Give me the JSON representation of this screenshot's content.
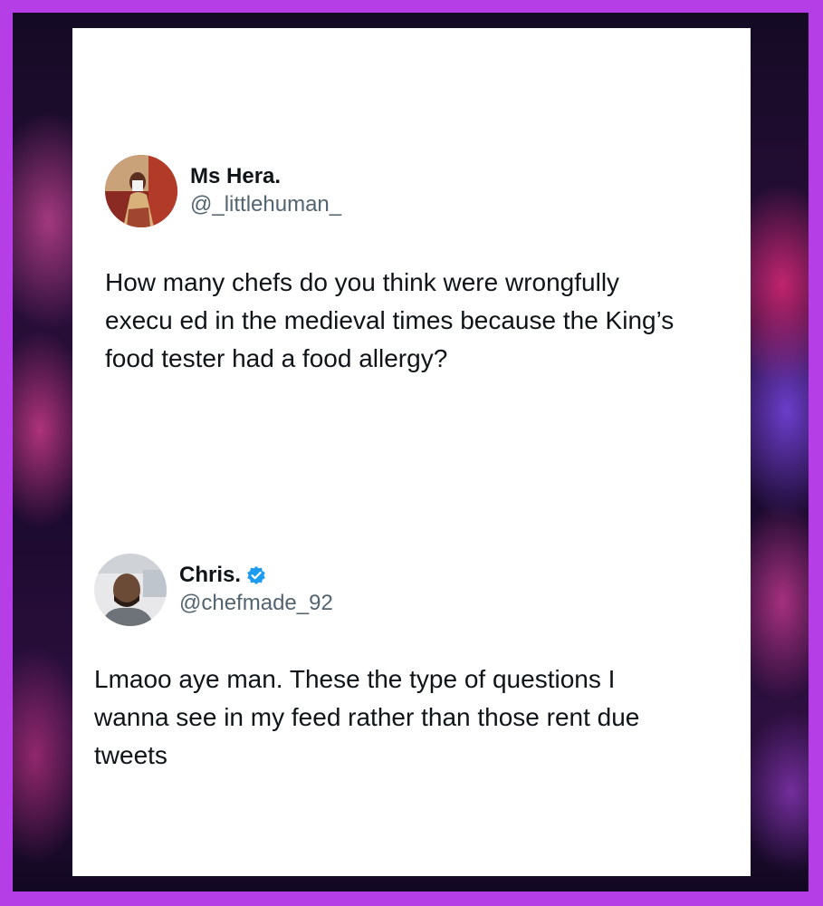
{
  "colors": {
    "frame": "#b53ee6",
    "card": "#ffffff",
    "text_primary": "#0f1419",
    "text_secondary": "#536471",
    "verified_badge": "#1d9bf0"
  },
  "tweets": [
    {
      "display_name": "Ms Hera.",
      "handle": "@_littlehuman_",
      "verified": false,
      "text": "How many chefs do you think were wrongfully\nexecu  ed in the medieval times because the King’s\nfood tester had a food allergy?"
    },
    {
      "display_name": "Chris.",
      "handle": "@chefmade_92",
      "verified": true,
      "verified_icon": "verified-badge-icon",
      "text": "Lmaoo aye man. These the type of questions I\nwanna see in my feed rather than those rent due\ntweets"
    }
  ]
}
